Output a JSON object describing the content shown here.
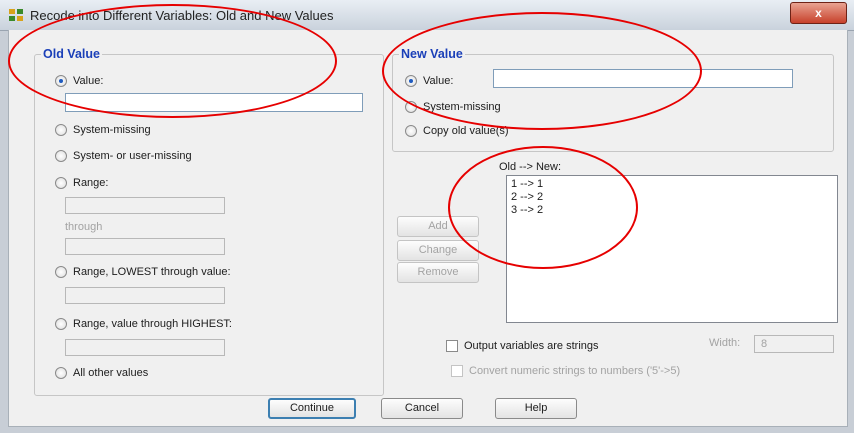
{
  "window": {
    "title": "Recode into Different Variables: Old and New Values",
    "close_label": "x"
  },
  "old_value": {
    "legend": "Old Value",
    "value_label": "Value:",
    "value_input": "",
    "system_missing": "System-missing",
    "system_or_user_missing": "System- or user-missing",
    "range": "Range:",
    "through": "through",
    "range_lowest": "Range, LOWEST through value:",
    "range_highest": "Range, value through HIGHEST:",
    "all_other": "All other values"
  },
  "new_value": {
    "legend": "New Value",
    "value_label": "Value:",
    "value_input": "",
    "system_missing": "System-missing",
    "copy_old": "Copy old value(s)"
  },
  "mapping": {
    "header": "Old --> New:",
    "items": [
      "1 --> 1",
      "2 --> 2",
      "3 --> 2"
    ]
  },
  "buttons": {
    "add": "Add",
    "change": "Change",
    "remove": "Remove",
    "continue": "Continue",
    "cancel": "Cancel",
    "help": "Help"
  },
  "options": {
    "output_strings": "Output variables are strings",
    "width_label": "Width:",
    "width_value": "8",
    "convert_numeric": "Convert numeric strings to numbers ('5'->5)"
  },
  "colors": {
    "legend": "#1a3fb8",
    "annotation": "#e60000",
    "accent": "#1e5bbf"
  }
}
